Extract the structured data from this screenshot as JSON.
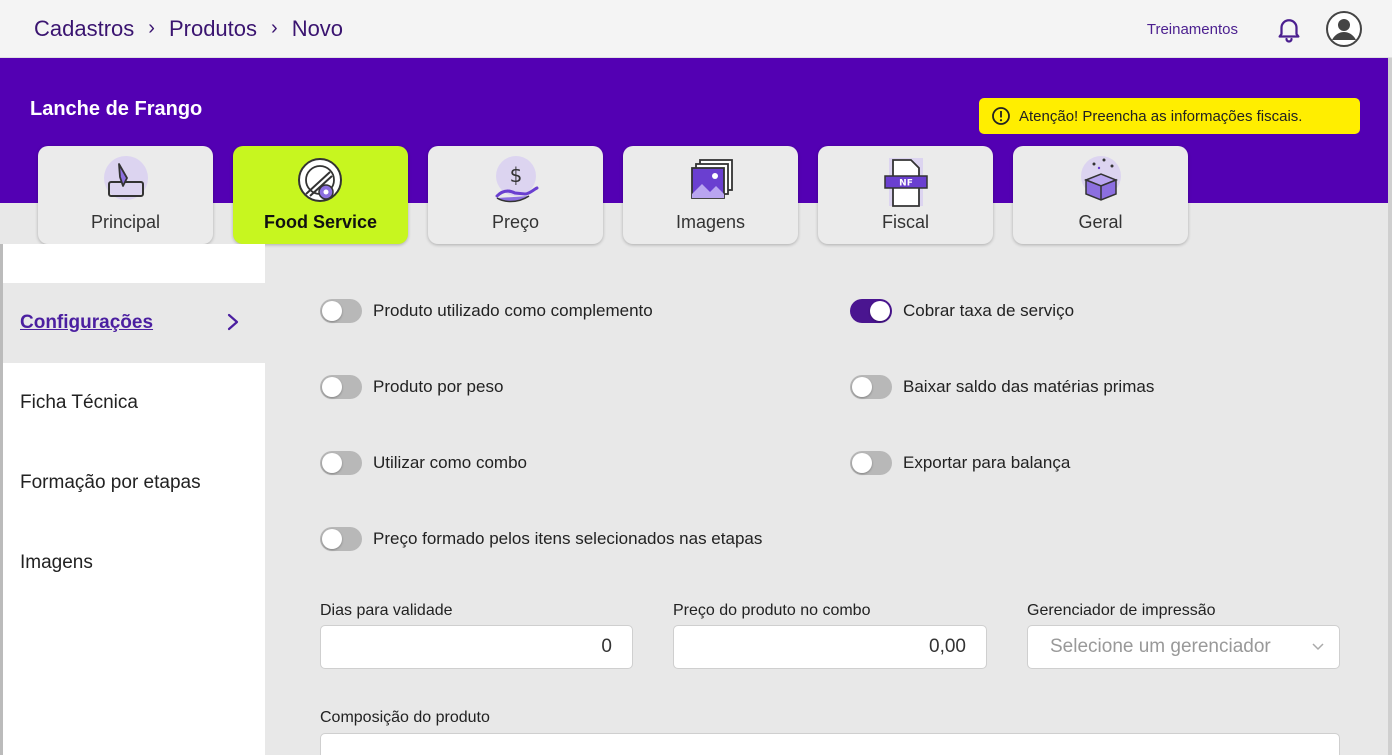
{
  "breadcrumb": [
    "Cadastros",
    "Produtos",
    "Novo"
  ],
  "top": {
    "training_label": "Treinamentos",
    "bell_icon": "bell-icon",
    "avatar_icon": "user-avatar-icon"
  },
  "product": {
    "name": "Lanche de Frango"
  },
  "alert": {
    "text": "Atenção! Preencha as informações fiscais.",
    "icon": "alert-circle-icon",
    "color": "#ffee00"
  },
  "tabs": [
    {
      "label": "Principal",
      "icon": "pencil-edit-icon"
    },
    {
      "label": "Food Service",
      "icon": "plate-cutlery-icon",
      "active": true
    },
    {
      "label": "Preço",
      "icon": "hand-dollar-icon"
    },
    {
      "label": "Imagens",
      "icon": "images-icon"
    },
    {
      "label": "Fiscal",
      "icon": "nf-document-icon",
      "badge": "NF"
    },
    {
      "label": "Geral",
      "icon": "open-box-icon"
    }
  ],
  "sidebar": {
    "items": [
      {
        "label": "Configurações",
        "active": true
      },
      {
        "label": "Ficha Técnica"
      },
      {
        "label": "Formação por etapas"
      },
      {
        "label": "Imagens"
      }
    ]
  },
  "toggles": {
    "complemento": {
      "label": "Produto utilizado como complemento",
      "on": false
    },
    "taxa_servico": {
      "label": "Cobrar taxa de serviço",
      "on": true
    },
    "peso": {
      "label": "Produto por peso",
      "on": false
    },
    "materias_primas": {
      "label": "Baixar saldo das matérias primas",
      "on": false
    },
    "combo": {
      "label": "Utilizar como combo",
      "on": false
    },
    "balanca": {
      "label": "Exportar para balança",
      "on": false
    },
    "preco_etapas": {
      "label": "Preço formado pelos itens selecionados nas etapas",
      "on": false
    }
  },
  "fields": {
    "dias_validade": {
      "label": "Dias para validade",
      "value": "0"
    },
    "preco_combo": {
      "label": "Preço do produto no combo",
      "value": "0,00"
    },
    "gerenciador": {
      "label": "Gerenciador de impressão",
      "placeholder": "Selecione um gerenciador"
    },
    "composicao": {
      "label": "Composição do produto",
      "value": ""
    }
  },
  "colors": {
    "primary_purple": "#5300b3",
    "active_tab": "#c7f61f",
    "toggle_on": "#4a1590"
  }
}
